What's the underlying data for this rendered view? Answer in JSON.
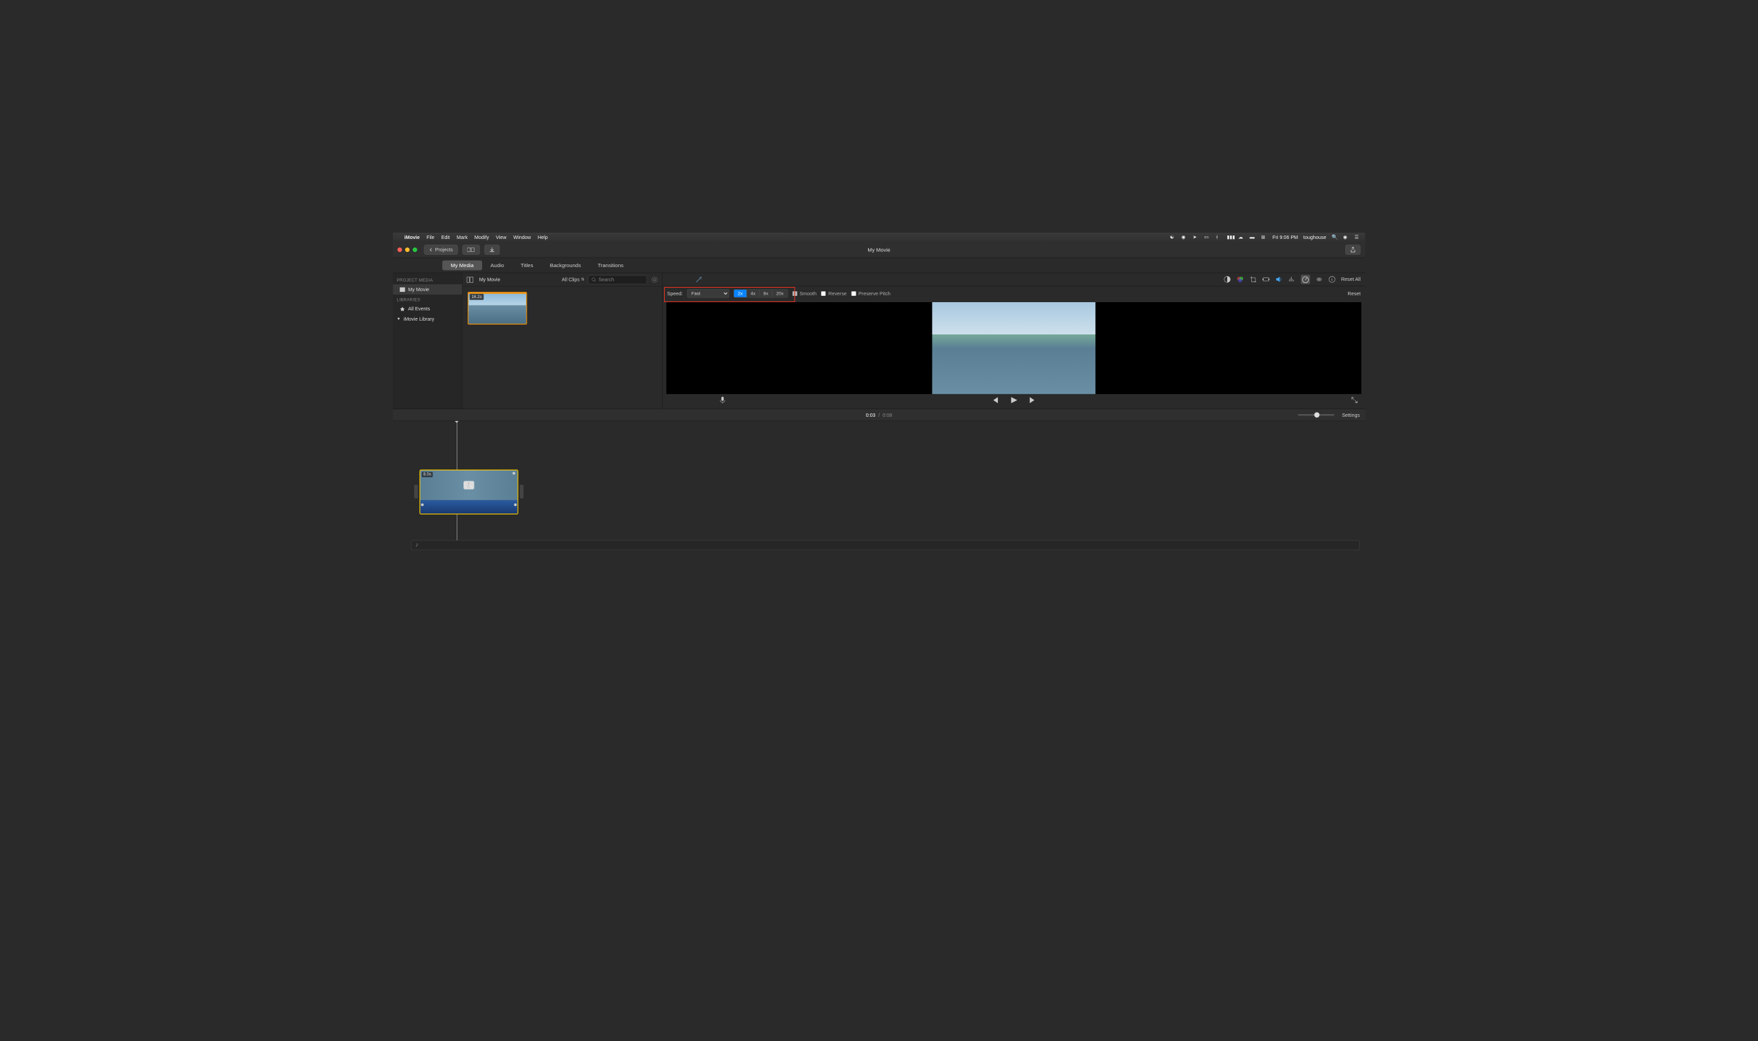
{
  "menubar": {
    "app": "iMovie",
    "items": [
      "File",
      "Edit",
      "Mark",
      "Modify",
      "View",
      "Window",
      "Help"
    ],
    "clock": "Fri 9:06 PM",
    "user": "toughouse"
  },
  "titlebar": {
    "back_label": "Projects",
    "title": "My Movie"
  },
  "tabs": {
    "items": [
      "My Media",
      "Audio",
      "Titles",
      "Backgrounds",
      "Transitions"
    ],
    "active": 0
  },
  "sidebar": {
    "hdr1": "PROJECT MEDIA",
    "project": "My Movie",
    "hdr2": "LIBRARIES",
    "all_events": "All Events",
    "library": "iMovie Library"
  },
  "media": {
    "crumb": "My Movie",
    "allclips": "All Clips",
    "search_placeholder": "Search",
    "clip_duration": "16.2s"
  },
  "adjust": {
    "reset_all": "Reset All"
  },
  "speed": {
    "label": "Speed:",
    "value": "Fast",
    "options": [
      "2x",
      "4x",
      "8x",
      "20x"
    ],
    "active": 0,
    "smooth": "Smooth",
    "reverse": "Reverse",
    "preserve": "Preserve Pitch",
    "reset": "Reset"
  },
  "playback": {
    "current": "0:03",
    "sep": "/",
    "total": "0:08",
    "settings": "Settings"
  },
  "timeline": {
    "clip_duration": "8.0s"
  }
}
